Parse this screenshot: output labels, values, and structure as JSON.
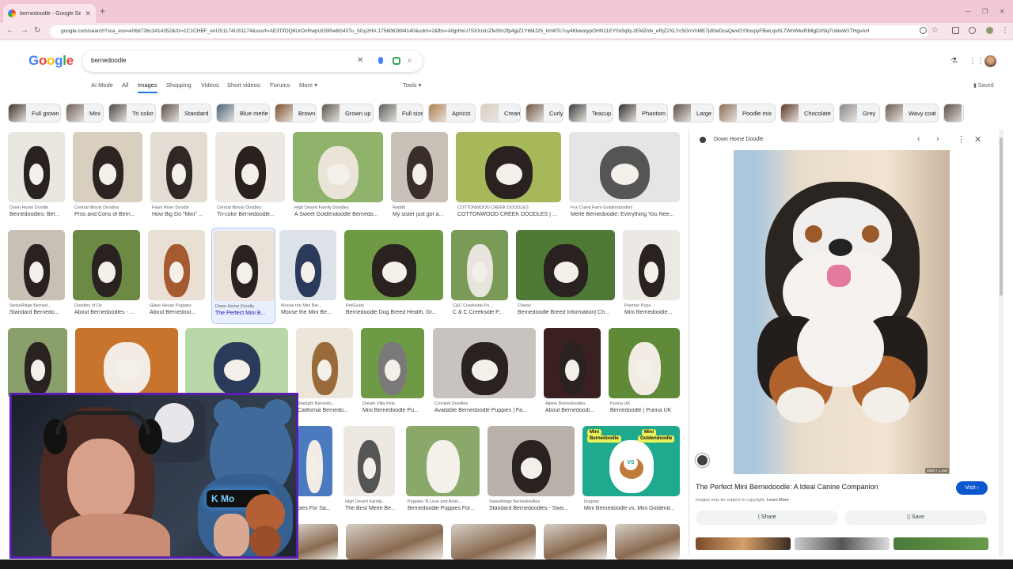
{
  "browser": {
    "tab_title": "bernedoodle - Google Search",
    "url": "google.com/search?sca_esv=e06d726c3414352&rlz=1C1CHBF_enUS1174US1174&sxsrf=AE3TifOQ6UrDnRwpUG5Rw8G43Tu_5Gy2HA:1756062894140&udm=2&fbs=AIljpHxU7SXXniUZfeShr2fp4giZ1Y6MJ25_tmWTc7uy4KlewuypOHN11EY0n5qfq-zEMZldv_eRjZ2XLYc5GnVnME7jd0wDcaQwvGYltospyFBwLqv0L7WnWkxRMlgDX9q7UkleW1THgvAH"
  },
  "logo": {
    "g1": "G",
    "o1": "o",
    "o2": "o",
    "g2": "g",
    "l": "l",
    "e": "e"
  },
  "search": {
    "query": "bernedoodle"
  },
  "nav_tabs": [
    "AI Mode",
    "All",
    "Images",
    "Shopping",
    "Videos",
    "Short videos",
    "Forums",
    "More ▾",
    "Tools ▾"
  ],
  "saved_label": "Saved",
  "chips": [
    "Full grown",
    "Mini",
    "Tri color",
    "Standard",
    "Blue merle",
    "Brown",
    "Grown up",
    "Full size",
    "Apricot",
    "Cream",
    "Curly",
    "Teacup",
    "Phantom",
    "Large",
    "Poodle mix",
    "Chocolate",
    "Grey",
    "Wavy coat"
  ],
  "results": [
    {
      "src": "Down Home Doodle",
      "title": "Bernedoodles: Ber..."
    },
    {
      "src": "Central Illinois Doodles",
      "title": "Pros and Cons of Bern..."
    },
    {
      "src": "Fawn River Doodle",
      "title": "How Big Do \"Mini\" ..."
    },
    {
      "src": "Central Illinois Doodles",
      "title": "Tri-color Bernedoodle..."
    },
    {
      "src": "High Desert Family Doodles",
      "title": "A Sweet Goldendoodle Bernedo..."
    },
    {
      "src": "Reddit",
      "title": "My sister just got a..."
    },
    {
      "src": "COTTONWOOD CREEK DOODLES",
      "title": "COTTONWOOD CREEK DOODLES | ..."
    },
    {
      "src": "Fox Creek Farm Goldendoodles",
      "title": "Merle Bernedoodle: Everything You Nee..."
    },
    {
      "src": "SwissRidge Berned...",
      "title": "Standard Bernedo..."
    },
    {
      "src": "Doodles of Oz",
      "title": "About Bernedoodles - ..."
    },
    {
      "src": "Glass House Puppies",
      "title": "About Bernedool..."
    },
    {
      "src": "Down Home Doodle",
      "title": "The Perfect Mini B..."
    },
    {
      "src": "Moose the Mini Ber...",
      "title": "Moose the Mini Be..."
    },
    {
      "src": "PetGuide",
      "title": "Bernedoodle Dog Breed Health, Gr..."
    },
    {
      "src": "C&C Creekside Po...",
      "title": "C & C Creekside P..."
    },
    {
      "src": "Chewy",
      "title": "Bernedoodle Breed Information| Ch..."
    },
    {
      "src": "Premier Pups",
      "title": "Mini Bernedoodle..."
    },
    {
      "src": "Starlight Bernedo...",
      "title": "California Bernedo..."
    },
    {
      "src": "Dream Villa Pets",
      "title": "Mini Bernedoodle Pu..."
    },
    {
      "src": "Crockett Doodles",
      "title": "Available Bernedoodle Puppies | Fa..."
    },
    {
      "src": "Alpine Bernedoodles",
      "title": "About Bernedoodl..."
    },
    {
      "src": "Purina UK",
      "title": "Bernedoodle | Purina UK"
    },
    {
      "src": "",
      "title": "pies For Sa..."
    },
    {
      "src": "High Desert Family...",
      "title": "The Best Merle Be..."
    },
    {
      "src": "Puppies 'N Love and Anim...",
      "title": "Bernedoodle Puppies For..."
    },
    {
      "src": "SwissRidge Bernedoodles",
      "title": "Standard Bernedoodles - Swis..."
    },
    {
      "src": "Dogster",
      "title": "Mini Bernedoodle vs. Mini Goldend..."
    }
  ],
  "card_text": {
    "a": "Mini",
    "b": "Bernedoodle",
    "c": "VS",
    "d": "Mini",
    "e": "Goldendoodle"
  },
  "panel": {
    "source": "Down Home Doodle",
    "title": "The Perfect Mini Bernedoodle: A Ideal Canine Companion",
    "visit": "Visit ›",
    "copyright": "Images may be subject to copyright.",
    "learn_more": "Learn More",
    "share": "Share",
    "save": "Save",
    "dimensions": "1000 × 1,450"
  },
  "overlay": {
    "lanyard": "K Mo"
  }
}
